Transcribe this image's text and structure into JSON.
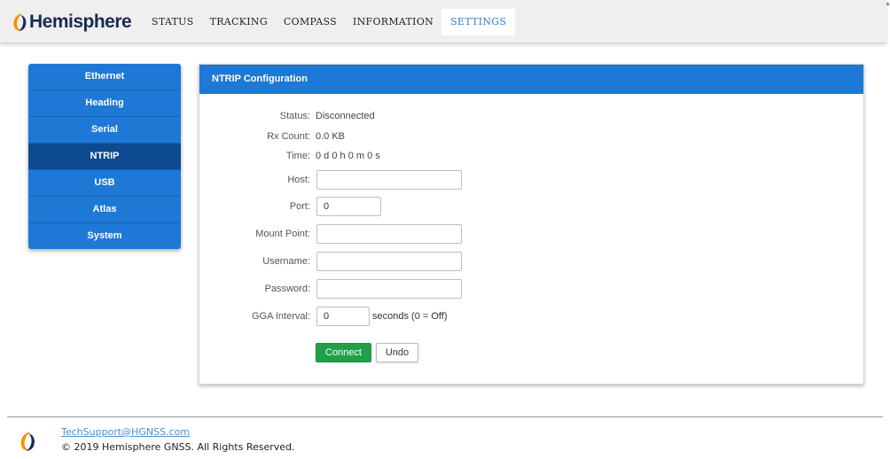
{
  "brand": {
    "name": "Hemisphere",
    "logo_color": "#ff8c00"
  },
  "nav": {
    "items": [
      {
        "label": "STATUS"
      },
      {
        "label": "TRACKING"
      },
      {
        "label": "COMPASS"
      },
      {
        "label": "INFORMATION"
      },
      {
        "label": "SETTINGS",
        "active": true
      }
    ]
  },
  "sidebar": {
    "items": [
      {
        "label": "Ethernet"
      },
      {
        "label": "Heading"
      },
      {
        "label": "Serial"
      },
      {
        "label": "NTRIP",
        "active": true
      },
      {
        "label": "USB"
      },
      {
        "label": "Atlas"
      },
      {
        "label": "System"
      }
    ]
  },
  "panel": {
    "title": "NTRIP Configuration",
    "status": {
      "label": "Status:",
      "value": "Disconnected"
    },
    "rx_count": {
      "label": "Rx Count:",
      "value": "0.0 KB"
    },
    "time": {
      "label": "Time:",
      "value": "0 d 0 h 0 m 0 s"
    },
    "host": {
      "label": "Host:",
      "value": ""
    },
    "port": {
      "label": "Port:",
      "value": "0"
    },
    "mount_point": {
      "label": "Mount Point:",
      "value": ""
    },
    "username": {
      "label": "Username:",
      "value": ""
    },
    "password": {
      "label": "Password:",
      "value": ""
    },
    "gga_interval": {
      "label": "GGA Interval:",
      "value": "0",
      "suffix": "seconds (0 = Off)"
    },
    "connect_label": "Connect",
    "undo_label": "Undo"
  },
  "footer": {
    "email": "TechSupport@HGNSS.com",
    "copyright": "© 2019 Hemisphere GNSS. All Rights Reserved."
  },
  "colors": {
    "accent": "#1e78d6",
    "sidebar_active": "#0d4a8f",
    "connect": "#21a04a",
    "nav_active_text": "#2a7fd3"
  }
}
